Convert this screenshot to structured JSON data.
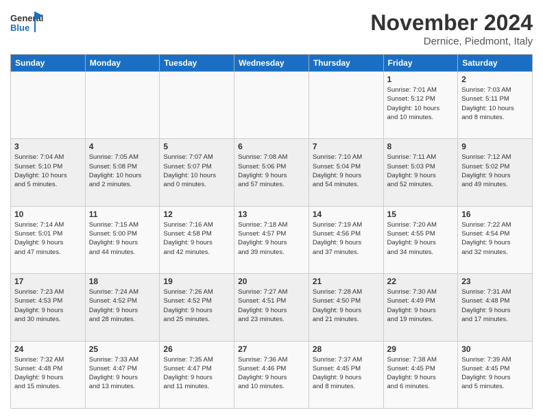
{
  "header": {
    "logo_text_general": "General",
    "logo_text_blue": "Blue",
    "month": "November 2024",
    "location": "Dernice, Piedmont, Italy"
  },
  "weekdays": [
    "Sunday",
    "Monday",
    "Tuesday",
    "Wednesday",
    "Thursday",
    "Friday",
    "Saturday"
  ],
  "weeks": [
    [
      {
        "day": "",
        "info": ""
      },
      {
        "day": "",
        "info": ""
      },
      {
        "day": "",
        "info": ""
      },
      {
        "day": "",
        "info": ""
      },
      {
        "day": "",
        "info": ""
      },
      {
        "day": "1",
        "info": "Sunrise: 7:01 AM\nSunset: 5:12 PM\nDaylight: 10 hours\nand 10 minutes."
      },
      {
        "day": "2",
        "info": "Sunrise: 7:03 AM\nSunset: 5:11 PM\nDaylight: 10 hours\nand 8 minutes."
      }
    ],
    [
      {
        "day": "3",
        "info": "Sunrise: 7:04 AM\nSunset: 5:10 PM\nDaylight: 10 hours\nand 5 minutes."
      },
      {
        "day": "4",
        "info": "Sunrise: 7:05 AM\nSunset: 5:08 PM\nDaylight: 10 hours\nand 2 minutes."
      },
      {
        "day": "5",
        "info": "Sunrise: 7:07 AM\nSunset: 5:07 PM\nDaylight: 10 hours\nand 0 minutes."
      },
      {
        "day": "6",
        "info": "Sunrise: 7:08 AM\nSunset: 5:06 PM\nDaylight: 9 hours\nand 57 minutes."
      },
      {
        "day": "7",
        "info": "Sunrise: 7:10 AM\nSunset: 5:04 PM\nDaylight: 9 hours\nand 54 minutes."
      },
      {
        "day": "8",
        "info": "Sunrise: 7:11 AM\nSunset: 5:03 PM\nDaylight: 9 hours\nand 52 minutes."
      },
      {
        "day": "9",
        "info": "Sunrise: 7:12 AM\nSunset: 5:02 PM\nDaylight: 9 hours\nand 49 minutes."
      }
    ],
    [
      {
        "day": "10",
        "info": "Sunrise: 7:14 AM\nSunset: 5:01 PM\nDaylight: 9 hours\nand 47 minutes."
      },
      {
        "day": "11",
        "info": "Sunrise: 7:15 AM\nSunset: 5:00 PM\nDaylight: 9 hours\nand 44 minutes."
      },
      {
        "day": "12",
        "info": "Sunrise: 7:16 AM\nSunset: 4:58 PM\nDaylight: 9 hours\nand 42 minutes."
      },
      {
        "day": "13",
        "info": "Sunrise: 7:18 AM\nSunset: 4:57 PM\nDaylight: 9 hours\nand 39 minutes."
      },
      {
        "day": "14",
        "info": "Sunrise: 7:19 AM\nSunset: 4:56 PM\nDaylight: 9 hours\nand 37 minutes."
      },
      {
        "day": "15",
        "info": "Sunrise: 7:20 AM\nSunset: 4:55 PM\nDaylight: 9 hours\nand 34 minutes."
      },
      {
        "day": "16",
        "info": "Sunrise: 7:22 AM\nSunset: 4:54 PM\nDaylight: 9 hours\nand 32 minutes."
      }
    ],
    [
      {
        "day": "17",
        "info": "Sunrise: 7:23 AM\nSunset: 4:53 PM\nDaylight: 9 hours\nand 30 minutes."
      },
      {
        "day": "18",
        "info": "Sunrise: 7:24 AM\nSunset: 4:52 PM\nDaylight: 9 hours\nand 28 minutes."
      },
      {
        "day": "19",
        "info": "Sunrise: 7:26 AM\nSunset: 4:52 PM\nDaylight: 9 hours\nand 25 minutes."
      },
      {
        "day": "20",
        "info": "Sunrise: 7:27 AM\nSunset: 4:51 PM\nDaylight: 9 hours\nand 23 minutes."
      },
      {
        "day": "21",
        "info": "Sunrise: 7:28 AM\nSunset: 4:50 PM\nDaylight: 9 hours\nand 21 minutes."
      },
      {
        "day": "22",
        "info": "Sunrise: 7:30 AM\nSunset: 4:49 PM\nDaylight: 9 hours\nand 19 minutes."
      },
      {
        "day": "23",
        "info": "Sunrise: 7:31 AM\nSunset: 4:48 PM\nDaylight: 9 hours\nand 17 minutes."
      }
    ],
    [
      {
        "day": "24",
        "info": "Sunrise: 7:32 AM\nSunset: 4:48 PM\nDaylight: 9 hours\nand 15 minutes."
      },
      {
        "day": "25",
        "info": "Sunrise: 7:33 AM\nSunset: 4:47 PM\nDaylight: 9 hours\nand 13 minutes."
      },
      {
        "day": "26",
        "info": "Sunrise: 7:35 AM\nSunset: 4:47 PM\nDaylight: 9 hours\nand 11 minutes."
      },
      {
        "day": "27",
        "info": "Sunrise: 7:36 AM\nSunset: 4:46 PM\nDaylight: 9 hours\nand 10 minutes."
      },
      {
        "day": "28",
        "info": "Sunrise: 7:37 AM\nSunset: 4:45 PM\nDaylight: 9 hours\nand 8 minutes."
      },
      {
        "day": "29",
        "info": "Sunrise: 7:38 AM\nSunset: 4:45 PM\nDaylight: 9 hours\nand 6 minutes."
      },
      {
        "day": "30",
        "info": "Sunrise: 7:39 AM\nSunset: 4:45 PM\nDaylight: 9 hours\nand 5 minutes."
      }
    ]
  ]
}
